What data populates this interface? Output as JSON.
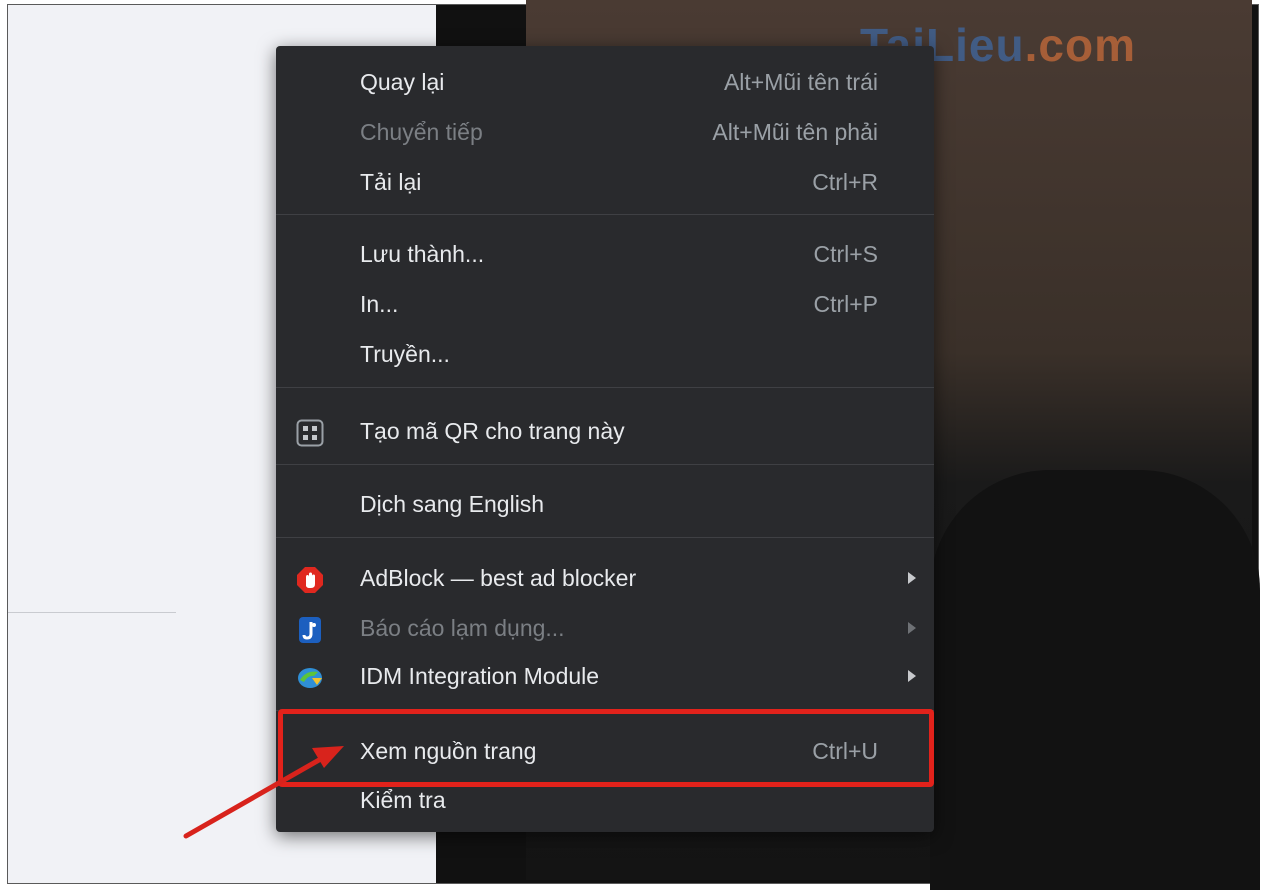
{
  "watermark": {
    "brand": "TaiLieu",
    "tld": ".com"
  },
  "menu": {
    "back": {
      "label": "Quay lại",
      "shortcut": "Alt+Mũi tên trái"
    },
    "forward": {
      "label": "Chuyển tiếp",
      "shortcut": "Alt+Mũi tên phải"
    },
    "reload": {
      "label": "Tải lại",
      "shortcut": "Ctrl+R"
    },
    "save_as": {
      "label": "Lưu thành...",
      "shortcut": "Ctrl+S"
    },
    "print": {
      "label": "In...",
      "shortcut": "Ctrl+P"
    },
    "cast": {
      "label": "Truyền..."
    },
    "qr": {
      "label": "Tạo mã QR cho trang này",
      "icon": "qr-code-icon"
    },
    "translate": {
      "label": "Dịch sang English"
    },
    "adblock": {
      "label": "AdBlock — best ad blocker",
      "icon": "adblock-icon"
    },
    "report_abuse": {
      "label": "Báo cáo lạm dụng...",
      "icon": "extension-j-icon"
    },
    "idm": {
      "label": "IDM Integration Module",
      "icon": "idm-icon"
    },
    "view_source": {
      "label": "Xem nguồn trang",
      "shortcut": "Ctrl+U"
    },
    "inspect": {
      "label": "Kiểm tra"
    }
  },
  "colors": {
    "menu_bg": "#292a2d",
    "highlight": "#e2221b",
    "adblock_red": "#e0281f",
    "arrow_red": "#d8231c"
  }
}
